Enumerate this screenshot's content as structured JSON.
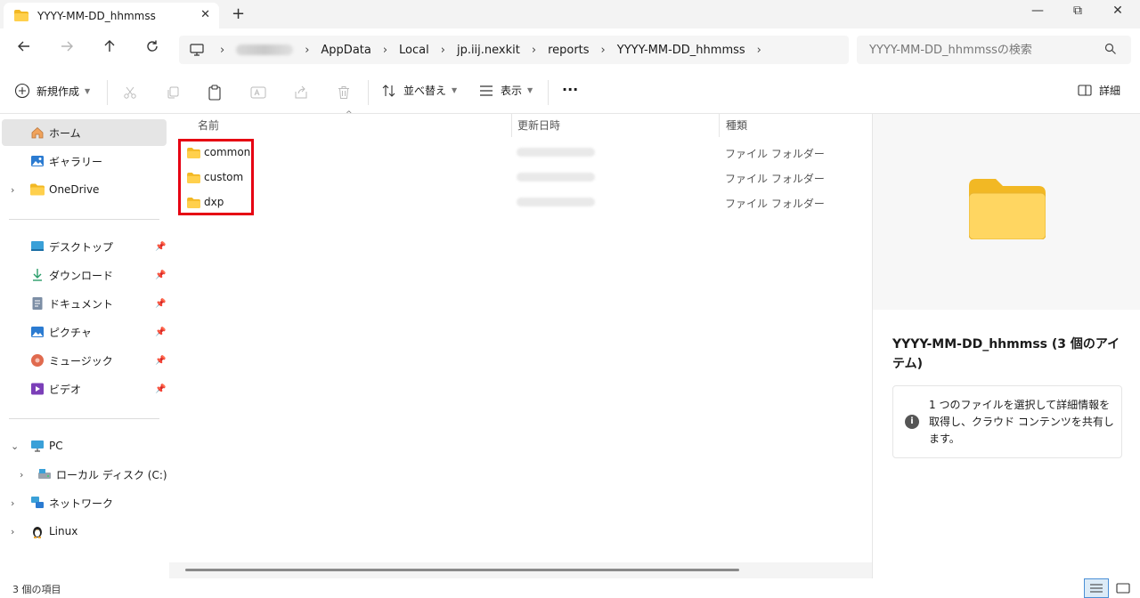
{
  "window": {
    "tab_title": "YYYY-MM-DD_hhmmss",
    "tab_close": "✕",
    "new_tab": "+",
    "minimize": "—",
    "maximize": "⧉",
    "close": "✕"
  },
  "address_bar": {
    "crumbs": [
      "AppData",
      "Local",
      "jp.iij.nexkit",
      "reports",
      "YYYY-MM-DD_hhmmss"
    ],
    "chevron": "›"
  },
  "search": {
    "placeholder": "YYYY-MM-DD_hhmmssの検索"
  },
  "toolbar": {
    "new_label": "新規作成",
    "sort_label": "並べ替え",
    "view_label": "表示",
    "more_label": "···",
    "details_label": "詳細"
  },
  "sidebar": {
    "home": "ホーム",
    "gallery": "ギャラリー",
    "onedrive": "OneDrive",
    "pinned": [
      "デスクトップ",
      "ダウンロード",
      "ドキュメント",
      "ピクチャ",
      "ミュージック",
      "ビデオ"
    ],
    "pc": "PC",
    "local_disk": "ローカル ディスク (C:)",
    "network": "ネットワーク",
    "linux": "Linux"
  },
  "columns": {
    "name": "名前",
    "modified": "更新日時",
    "type": "種類"
  },
  "files": [
    {
      "name": "common",
      "type": "ファイル フォルダー"
    },
    {
      "name": "custom",
      "type": "ファイル フォルダー"
    },
    {
      "name": "dxp",
      "type": "ファイル フォルダー"
    }
  ],
  "details": {
    "title": "YYYY-MM-DD_hhmmss (3 個のアイテム)",
    "info_text": "1 つのファイルを選択して詳細情報を取得し、クラウド コンテンツを共有します。",
    "info_icon": "i"
  },
  "status": {
    "items_count": "3 個の項目"
  },
  "colors": {
    "highlight": "#e60012",
    "folder": "#f7c948",
    "selected_bg": "#e5e5e5"
  }
}
